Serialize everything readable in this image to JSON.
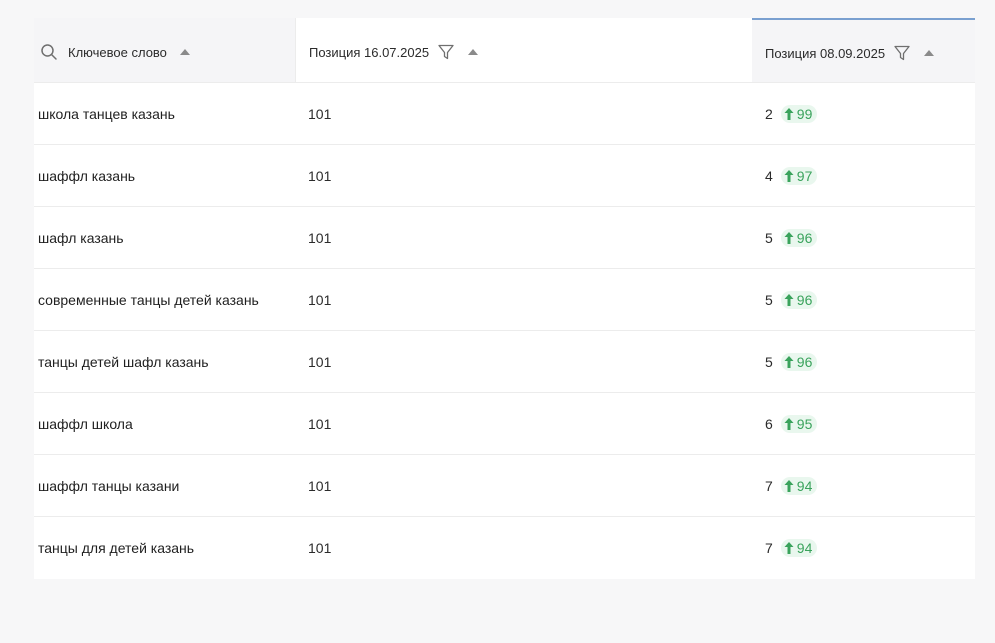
{
  "header": {
    "keyword_label": "Ключевое слово",
    "pos1_label": "Позиция 16.07.2025",
    "pos2_label": "Позиция 08.09.2025"
  },
  "rows": [
    {
      "keyword": "школа танцев казань",
      "pos1": "101",
      "pos2": "2",
      "delta": "99"
    },
    {
      "keyword": "шаффл казань",
      "pos1": "101",
      "pos2": "4",
      "delta": "97"
    },
    {
      "keyword": "шафл казань",
      "pos1": "101",
      "pos2": "5",
      "delta": "96"
    },
    {
      "keyword": "современные танцы детей казань",
      "pos1": "101",
      "pos2": "5",
      "delta": "96"
    },
    {
      "keyword": "танцы детей шафл казань",
      "pos1": "101",
      "pos2": "5",
      "delta": "96"
    },
    {
      "keyword": "шаффл школа",
      "pos1": "101",
      "pos2": "6",
      "delta": "95"
    },
    {
      "keyword": "шаффл танцы казани",
      "pos1": "101",
      "pos2": "7",
      "delta": "94"
    },
    {
      "keyword": "танцы для детей казань",
      "pos1": "101",
      "pos2": "7",
      "delta": "94"
    }
  ],
  "colors": {
    "delta_text": "#3aa35c",
    "delta_bg": "#e9f7ee",
    "active_column_border": "#7aa0d0"
  },
  "icons": {
    "search": "search-icon",
    "filter": "funnel-icon",
    "sort": "sort-ascending-icon",
    "delta": "arrow-up-icon"
  }
}
